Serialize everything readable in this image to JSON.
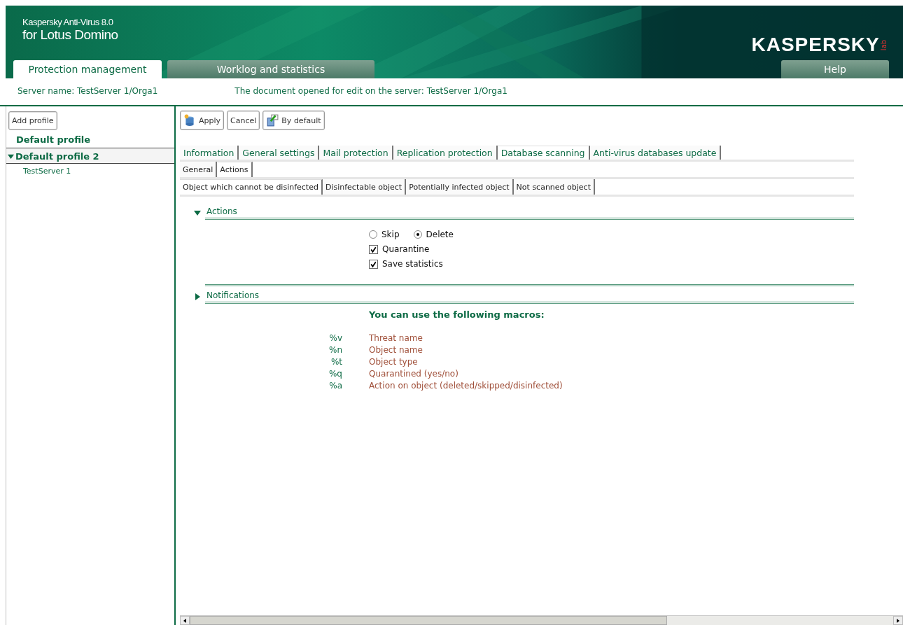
{
  "header": {
    "product_line1": "Kaspersky Anti-Virus 8.0",
    "product_line2": "for Lotus Domino",
    "logo": {
      "name": "KASPERSKY",
      "suffix": "lab"
    }
  },
  "main_tabs": [
    {
      "label": "Protection management",
      "selected": true
    },
    {
      "label": "Worklog and statistics",
      "selected": false
    }
  ],
  "help_tab": "Help",
  "info_bar": {
    "server": "Server name: TestServer 1/Orga1",
    "document": "The document opened for edit on the server: TestServer 1/Orga1"
  },
  "sidebar": {
    "add_button": "Add profile",
    "profiles": [
      {
        "label": "Default profile"
      },
      {
        "label": "Default profile 2",
        "expanded": true,
        "children": [
          {
            "label": "TestServer 1"
          }
        ]
      }
    ]
  },
  "toolbar": [
    {
      "label": "Apply"
    },
    {
      "label": "Cancel"
    },
    {
      "label": "By default"
    }
  ],
  "tabs": [
    {
      "label": "Information",
      "selected": false
    },
    {
      "label": "General settings",
      "selected": false
    },
    {
      "label": "Mail protection",
      "selected": false
    },
    {
      "label": "Replication protection",
      "selected": false
    },
    {
      "label": "Database scanning",
      "selected": true
    },
    {
      "label": "Anti-virus databases update",
      "selected": false
    }
  ],
  "subtabs": [
    {
      "label": "General",
      "selected": false
    },
    {
      "label": "Actions",
      "selected": true
    }
  ],
  "object_tabs": [
    {
      "label": "Object which cannot be disinfected",
      "selected": true
    },
    {
      "label": "Disinfectable object",
      "selected": false
    },
    {
      "label": "Potentially infected object",
      "selected": false
    },
    {
      "label": "Not scanned object",
      "selected": false
    }
  ],
  "actions_section": {
    "title": "Actions",
    "expanded": true,
    "radios": [
      {
        "label": "Skip",
        "selected": false
      },
      {
        "label": "Delete",
        "selected": true
      }
    ],
    "checkboxes": [
      {
        "label": "Quarantine",
        "checked": true
      },
      {
        "label": "Save statistics",
        "checked": true
      }
    ]
  },
  "notifications_section": {
    "title": "Notifications",
    "expanded": false
  },
  "macros": {
    "title": "You can use the following macros:",
    "items": [
      {
        "code": "%v",
        "description": "Threat name"
      },
      {
        "code": "%n",
        "description": "Object name"
      },
      {
        "code": "%t",
        "description": "Object type"
      },
      {
        "code": "%q",
        "description": "Quarantined (yes/no)"
      },
      {
        "code": "%a",
        "description": "Action on object (deleted/skipped/disinfected)"
      }
    ]
  }
}
